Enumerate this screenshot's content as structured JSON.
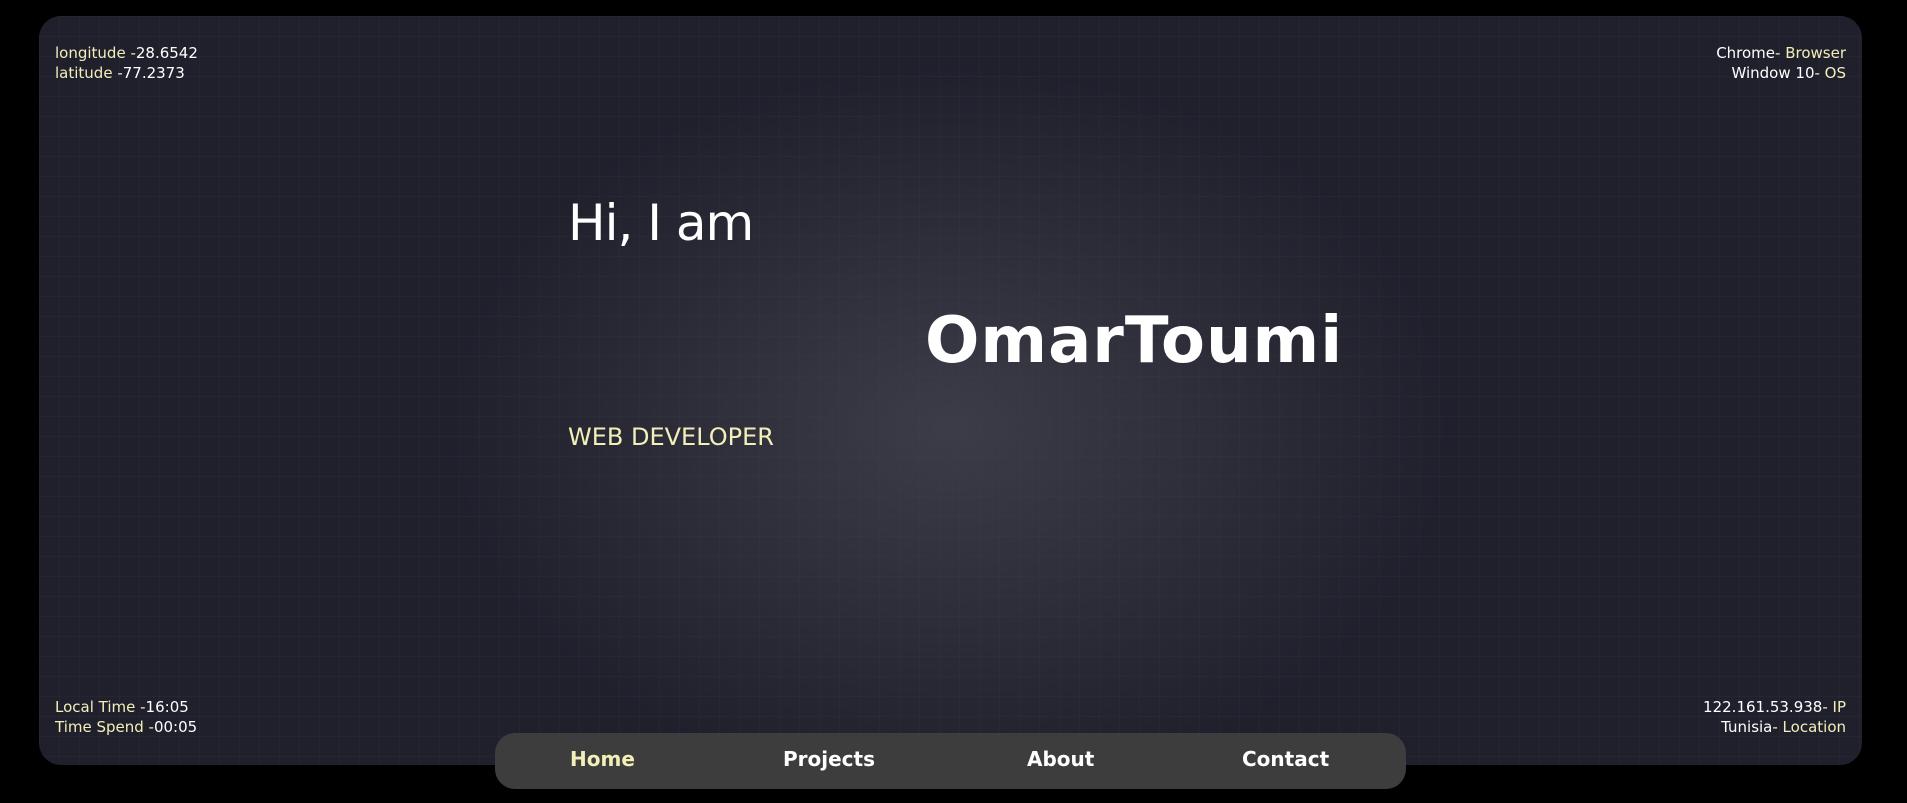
{
  "info": {
    "longitude_label": "longitude -",
    "longitude_value": "28.6542",
    "latitude_label": "latitude -",
    "latitude_value": "77.2373",
    "browser_name": "Chrome",
    "browser_label": "- Browser",
    "os_name": "Window 10",
    "os_label": "- OS",
    "local_time_label": "Local Time -",
    "local_time_value": "16:05",
    "time_spend_label": "Time Spend -",
    "time_spend_value": "00:05",
    "ip_value": "122.161.53.938",
    "ip_label": "- IP",
    "location_value": "Tunisia",
    "location_label": "- Location"
  },
  "hero": {
    "greeting": "Hi, I am",
    "name": "OmarToumi",
    "role": "WEB DEVELOPER"
  },
  "nav": {
    "items": [
      {
        "label": "Home"
      },
      {
        "label": "Projects"
      },
      {
        "label": "About"
      },
      {
        "label": "Contact"
      }
    ],
    "active": "Home"
  },
  "colors": {
    "accent": "#f2efb8",
    "background": "#20202d",
    "nav_bg": "#3d3d3d"
  }
}
